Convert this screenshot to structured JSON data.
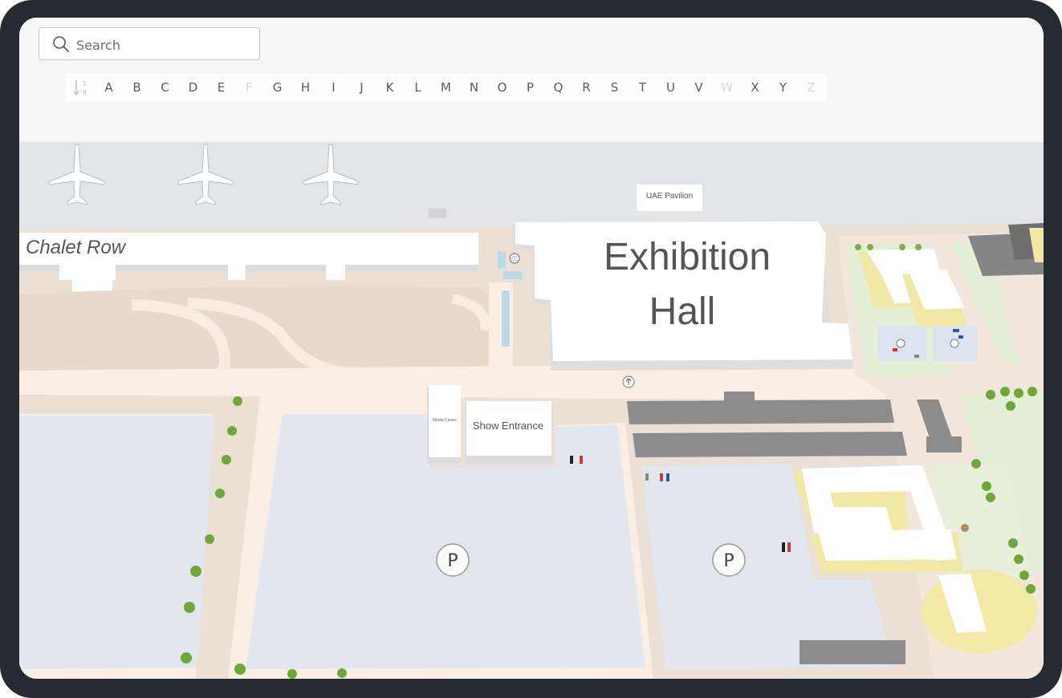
{
  "search": {
    "placeholder": "Search"
  },
  "index_bar": {
    "sort_label": "1 9",
    "letters": [
      {
        "label": "A",
        "enabled": true
      },
      {
        "label": "B",
        "enabled": true
      },
      {
        "label": "C",
        "enabled": true
      },
      {
        "label": "D",
        "enabled": true
      },
      {
        "label": "E",
        "enabled": true
      },
      {
        "label": "F",
        "enabled": false
      },
      {
        "label": "G",
        "enabled": true
      },
      {
        "label": "H",
        "enabled": true
      },
      {
        "label": "I",
        "enabled": true
      },
      {
        "label": "J",
        "enabled": true
      },
      {
        "label": "K",
        "enabled": true
      },
      {
        "label": "L",
        "enabled": true
      },
      {
        "label": "M",
        "enabled": true
      },
      {
        "label": "N",
        "enabled": true
      },
      {
        "label": "O",
        "enabled": true
      },
      {
        "label": "P",
        "enabled": true
      },
      {
        "label": "Q",
        "enabled": true
      },
      {
        "label": "R",
        "enabled": true
      },
      {
        "label": "S",
        "enabled": true
      },
      {
        "label": "T",
        "enabled": true
      },
      {
        "label": "U",
        "enabled": true
      },
      {
        "label": "V",
        "enabled": true
      },
      {
        "label": "W",
        "enabled": false
      },
      {
        "label": "X",
        "enabled": true
      },
      {
        "label": "Y",
        "enabled": true
      },
      {
        "label": "Z",
        "enabled": false
      }
    ]
  },
  "map": {
    "labels": {
      "chalet_row": "Chalet Row",
      "exhibition_hall_line1": "Exhibition",
      "exhibition_hall_line2": "Hall",
      "uae_pavilion": "UAE Pavilion",
      "show_entrance": "Show Entrance",
      "media_center": "Media Center"
    },
    "parking_symbol": "P",
    "colors": {
      "background": "#f6f6f6",
      "apron": "#e1e5ea",
      "ground": "#ecdfd3",
      "path": "#fbeee4",
      "parking": "#e2e6ee",
      "building": "#ffffff",
      "building_side": "#dcdcdc",
      "gray_building": "#8c8c8c",
      "yellow_building": "#f1e8a6",
      "green": "#e3efd6",
      "water": "#b8dbe6"
    }
  }
}
